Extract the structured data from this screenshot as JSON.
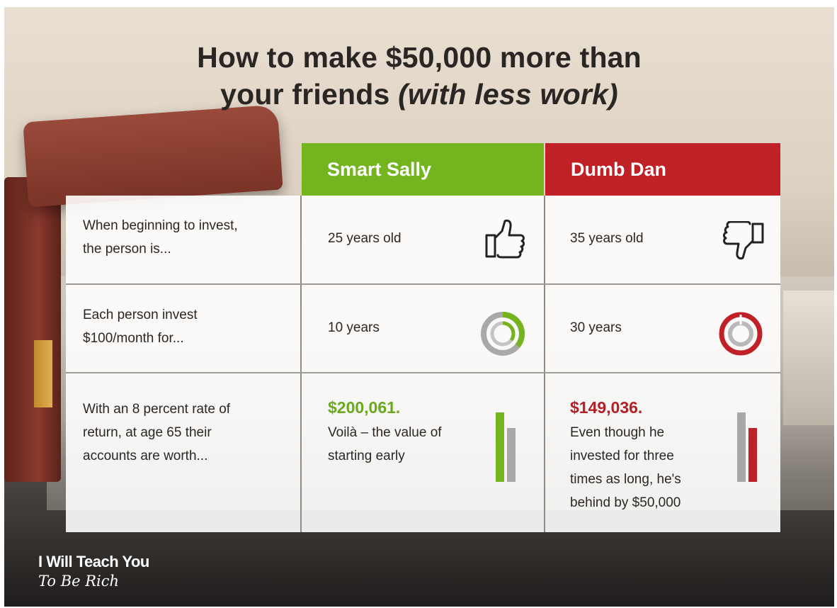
{
  "title": {
    "line1": "How to make $50,000 more than",
    "line2_plain": "your friends ",
    "line2_italic": "(with less work)"
  },
  "columns": {
    "sally": {
      "label": "Smart Sally",
      "color": "#73b41f"
    },
    "dan": {
      "label": "Dumb Dan",
      "color": "#bf2127"
    }
  },
  "rows": [
    {
      "label_lines": [
        "When beginning to invest,",
        "the person is..."
      ],
      "sally": "25 years old",
      "dan": "35 years old",
      "sally_icon": "thumbs-up-icon",
      "dan_icon": "thumbs-down-icon"
    },
    {
      "label_lines": [
        "Each person invest",
        "$100/month for..."
      ],
      "sally": "10 years",
      "dan": "30 years",
      "sally_icon": "progress-ring-icon",
      "dan_icon": "progress-ring-icon"
    },
    {
      "label_lines": [
        "With an 8 percent rate of",
        "return, at age 65 their",
        "accounts are worth..."
      ],
      "sally_value": "$200,061.",
      "sally_lines": [
        "Voilà – the value of",
        "starting early"
      ],
      "dan_value": "$149,036.",
      "dan_lines": [
        "Even though he",
        "invested for three",
        "times as long, he's",
        "behind by $50,000"
      ],
      "sally_icon": "bar-comparison-icon",
      "dan_icon": "bar-comparison-icon"
    }
  ],
  "brand": {
    "line1": "I Will Teach You",
    "line2": "To Be Rich"
  }
}
